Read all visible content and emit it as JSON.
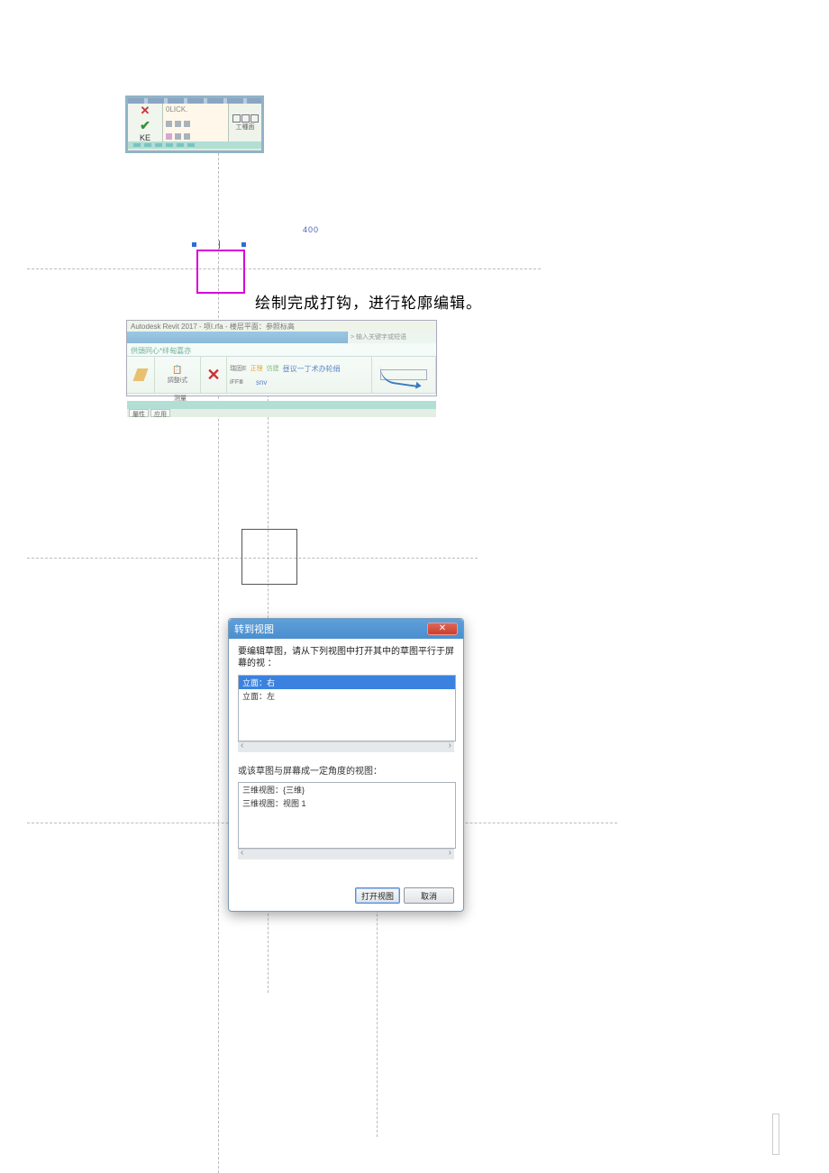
{
  "caption": "绘制完成打钩，进行轮廓编辑。",
  "dim_small": "400",
  "fig1": {
    "lock_label": "0LICK.",
    "right_label": "工種面",
    "left_label": "KE"
  },
  "fig2": {
    "app_title": "Autodesk Revit 2017 -      项I.rfa  - 楼层平面：参照标高",
    "search_placeholder": "> 输入关键字或短语",
    "green_text": "供頭同心*绊甸嘉亦",
    "labels": {
      "p1": "調整i式",
      "p2": "测量",
      "p3": "iFFⅢ",
      "p4": "snv",
      "p5": "昼议一丁术办轮绢",
      "p6": "瑞固E",
      "p7": "正理",
      "p8": "仿建"
    },
    "small_tabs": [
      "屬性",
      "应用"
    ]
  },
  "dialog": {
    "title": "转到视图",
    "msg_line1": "要编辑草图，请从下列视图中打开其中的草图平行于屏",
    "msg_line2": "幕的视 ：",
    "list1": [
      "立面：右",
      "立面：左"
    ],
    "label2": "或该草图与屏幕成一定角度的视图：",
    "list2": [
      "三维视图：{三维}",
      "三维视图：视图 1"
    ],
    "open_btn": "打开视图",
    "cancel_btn": "取消"
  }
}
